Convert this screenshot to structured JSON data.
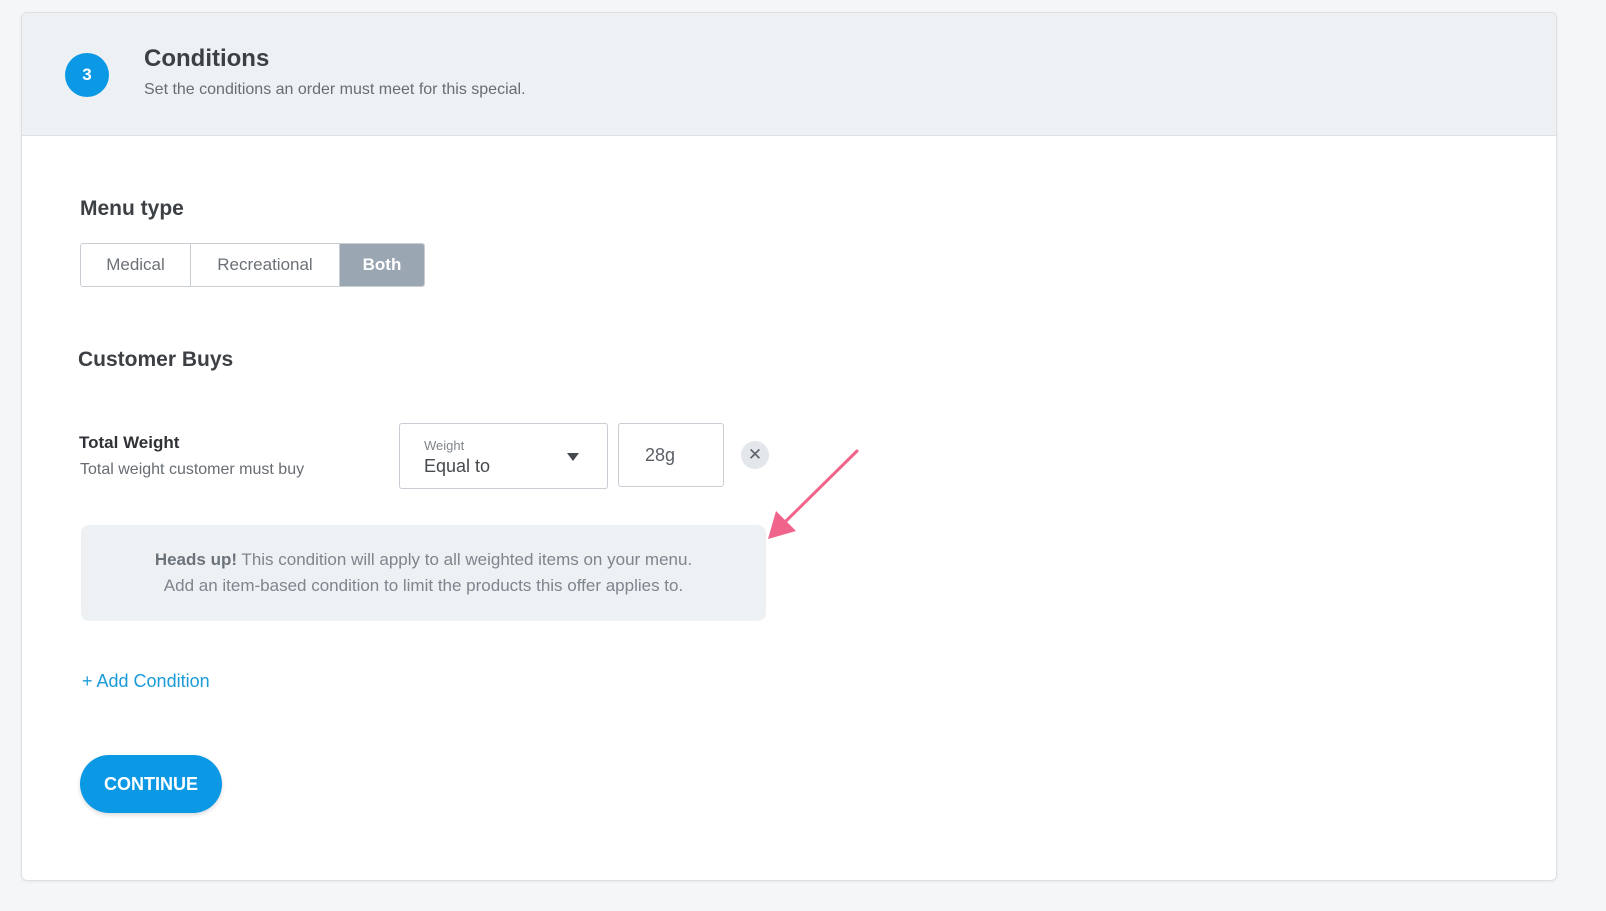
{
  "header": {
    "step_number": "3",
    "title": "Conditions",
    "subtitle": "Set the conditions an order must meet for this special."
  },
  "menu_type": {
    "title": "Menu type",
    "options": [
      "Medical",
      "Recreational",
      "Both"
    ],
    "selected": "Both"
  },
  "customer_buys": {
    "title": "Customer Buys",
    "condition": {
      "label": "Total Weight",
      "description": "Total weight customer must buy",
      "select_caption": "Weight",
      "select_value": "Equal to",
      "amount_value": "28g"
    }
  },
  "notice": {
    "bold": "Heads up!",
    "text": " This condition will apply to all weighted items on your menu.",
    "line2": "Add an item-based condition to limit the products this offer applies to."
  },
  "add_condition_label": "+ Add Condition",
  "continue_label": "CONTINUE",
  "colors": {
    "accent": "#0b99e6",
    "link": "#1a9bd8",
    "annotation_arrow": "#f0648c",
    "segment_active": "#9aa6b2"
  },
  "icons": {
    "remove": "close-icon",
    "dropdown": "chevron-down-icon",
    "annotation": "arrow-annotation-icon"
  }
}
